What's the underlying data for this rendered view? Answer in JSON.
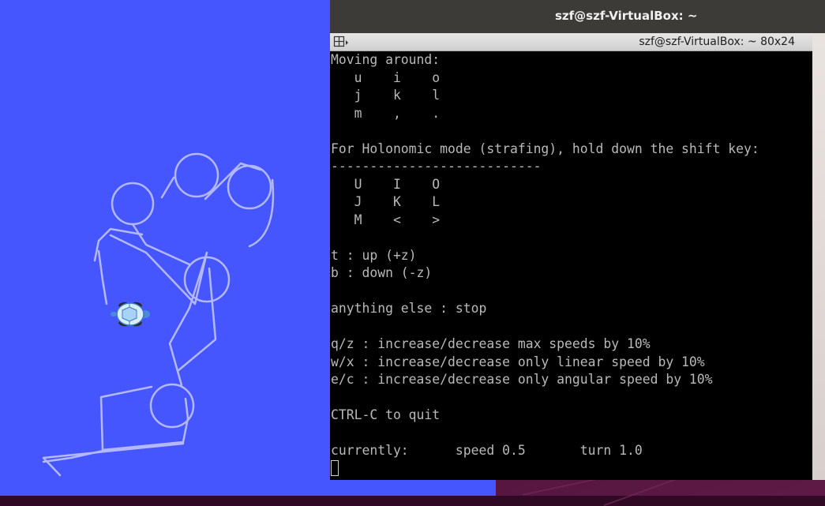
{
  "top_bar": {
    "title": "szf@szf-VirtualBox: ~"
  },
  "terminal": {
    "title": "szf@szf-VirtualBox: ~ 80x24",
    "menu_icon": "terminal-menu-icon",
    "lines": [
      "Moving around:",
      "   u    i    o",
      "   j    k    l",
      "   m    ,    .",
      "",
      "For Holonomic mode (strafing), hold down the shift key:",
      "---------------------------",
      "   U    I    O",
      "   J    K    L",
      "   M    <    >",
      "",
      "t : up (+z)",
      "b : down (-z)",
      "",
      "anything else : stop",
      "",
      "q/z : increase/decrease max speeds by 10%",
      "w/x : increase/decrease only linear speed by 10%",
      "e/c : increase/decrease only angular speed by 10%",
      "",
      "CTRL-C to quit",
      "",
      "currently:      speed 0.5       turn 1.0"
    ]
  },
  "turtlesim": {
    "background_color": "#4556ff",
    "trail_color": "#b3b8ff",
    "turtle_icon": "turtle-icon"
  }
}
